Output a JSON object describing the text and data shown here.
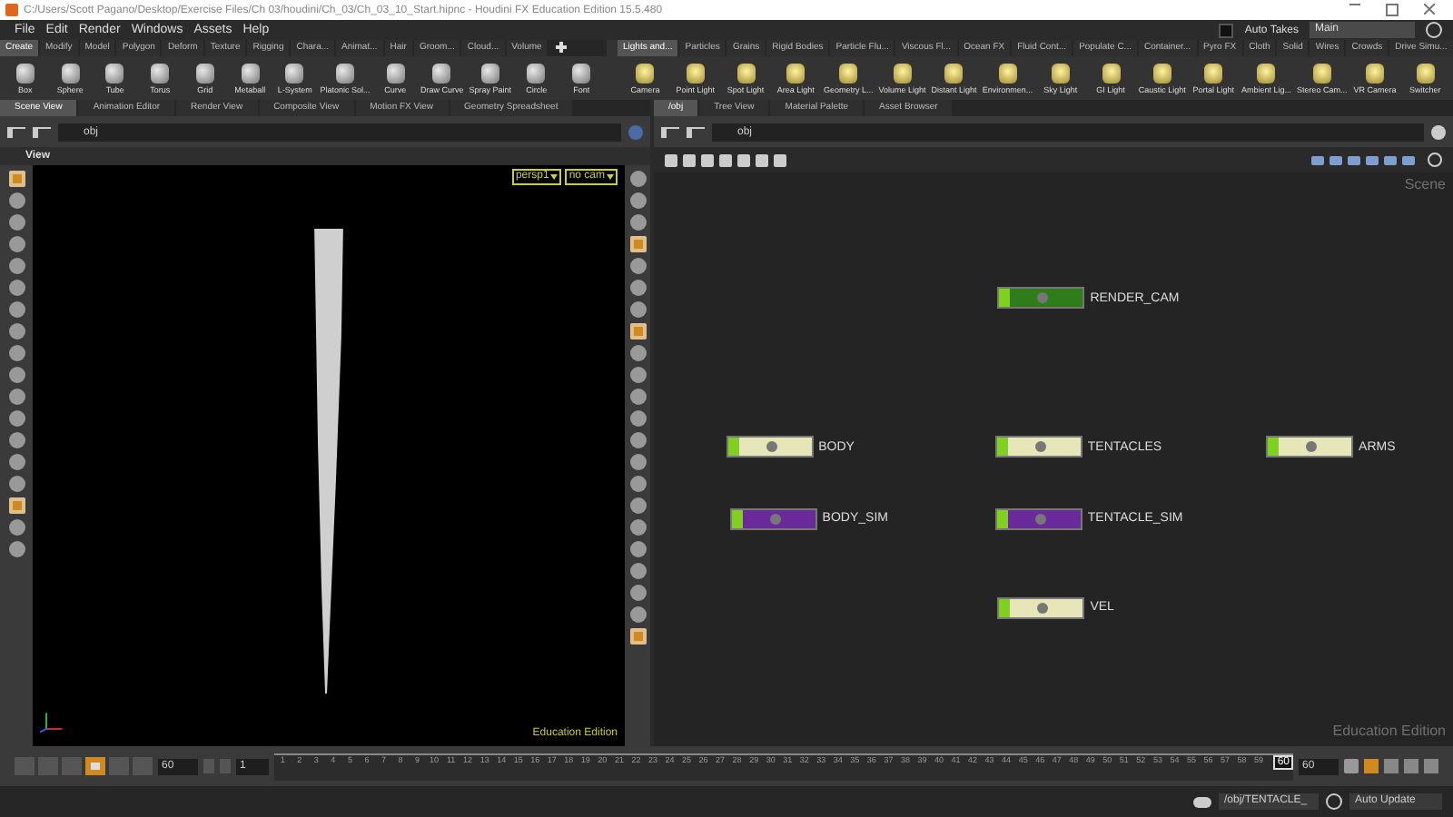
{
  "window": {
    "title": "C:/Users/Scott Pagano/Desktop/Exercise Files/Ch 03/houdini/Ch_03/Ch_03_10_Start.hipnc - Houdini FX Education Edition 15.5.480"
  },
  "menu": [
    "File",
    "Edit",
    "Render",
    "Windows",
    "Assets",
    "Help"
  ],
  "auto_takes": {
    "label": "Auto Takes",
    "checked": false
  },
  "take": "Main",
  "shelf_left": {
    "tabs": [
      {
        "label": "Create",
        "selected": true
      },
      {
        "label": "Modify",
        "selected": false
      },
      {
        "label": "Model",
        "selected": false
      },
      {
        "label": "Polygon",
        "selected": false
      },
      {
        "label": "Deform",
        "selected": false
      },
      {
        "label": "Texture",
        "selected": false
      },
      {
        "label": "Rigging",
        "selected": false
      },
      {
        "label": "Chara...",
        "selected": false
      },
      {
        "label": "Animat...",
        "selected": false
      },
      {
        "label": "Hair",
        "selected": false
      },
      {
        "label": "Groom...",
        "selected": false
      },
      {
        "label": "Cloud...",
        "selected": false
      },
      {
        "label": "Volume",
        "selected": false
      }
    ],
    "tools": [
      "Box",
      "Sphere",
      "Tube",
      "Torus",
      "Grid",
      "Metaball",
      "L-System",
      "Platonic Sol...",
      "Curve",
      "Draw Curve",
      "Spray Paint",
      "Circle",
      "Font"
    ]
  },
  "shelf_right": {
    "tabs": [
      {
        "label": "Lights and...",
        "selected": true
      },
      {
        "label": "Particles",
        "selected": false
      },
      {
        "label": "Grains",
        "selected": false
      },
      {
        "label": "Rigid Bodies",
        "selected": false
      },
      {
        "label": "Particle Flu...",
        "selected": false
      },
      {
        "label": "Viscous Fl...",
        "selected": false
      },
      {
        "label": "Ocean FX",
        "selected": false
      },
      {
        "label": "Fluid Cont...",
        "selected": false
      },
      {
        "label": "Populate C...",
        "selected": false
      },
      {
        "label": "Container...",
        "selected": false
      },
      {
        "label": "Pyro FX",
        "selected": false
      },
      {
        "label": "Cloth",
        "selected": false
      },
      {
        "label": "Solid",
        "selected": false
      },
      {
        "label": "Wires",
        "selected": false
      },
      {
        "label": "Crowds",
        "selected": false
      },
      {
        "label": "Drive Simu...",
        "selected": false
      }
    ],
    "tools": [
      "Camera",
      "Point Light",
      "Spot Light",
      "Area Light",
      "Geometry L...",
      "Volume Light",
      "Distant Light",
      "Environmen...",
      "Sky Light",
      "GI Light",
      "Caustic Light",
      "Portal Light",
      "Ambient Lig...",
      "Stereo Cam...",
      "VR Camera",
      "Switcher"
    ]
  },
  "left_pane": {
    "tabs": [
      {
        "label": "Scene View",
        "selected": true
      },
      {
        "label": "Animation Editor",
        "selected": false
      },
      {
        "label": "Render View",
        "selected": false
      },
      {
        "label": "Composite View",
        "selected": false
      },
      {
        "label": "Motion FX View",
        "selected": false
      },
      {
        "label": "Geometry Spreadsheet",
        "selected": false
      }
    ],
    "path": "obj",
    "viewport": {
      "title": "View",
      "camera": "persp1",
      "cam_menu": "no cam",
      "edition": "Education Edition",
      "left_tools": [
        {
          "selected": true
        },
        {
          "selected": false
        },
        {
          "selected": false
        },
        {
          "selected": false
        },
        {
          "selected": false
        },
        {
          "selected": false
        },
        {
          "selected": false
        },
        {
          "selected": false
        },
        {
          "selected": false
        },
        {
          "selected": false
        },
        {
          "selected": false
        },
        {
          "selected": false
        },
        {
          "selected": false
        },
        {
          "selected": false
        },
        {
          "selected": false
        },
        {
          "selected": true
        },
        {
          "selected": false
        },
        {
          "selected": false
        }
      ],
      "right_tools": [
        {
          "selected": false
        },
        {
          "selected": false
        },
        {
          "selected": false
        },
        {
          "selected": true
        },
        {
          "selected": false
        },
        {
          "selected": false
        },
        {
          "selected": false
        },
        {
          "selected": true
        },
        {
          "selected": false
        },
        {
          "selected": false
        },
        {
          "selected": false
        },
        {
          "selected": false
        },
        {
          "selected": false
        },
        {
          "selected": false
        },
        {
          "selected": false
        },
        {
          "selected": false
        },
        {
          "selected": false
        },
        {
          "selected": false
        },
        {
          "selected": false
        },
        {
          "selected": false
        },
        {
          "selected": false
        },
        {
          "selected": true
        }
      ]
    }
  },
  "right_pane": {
    "tabs": [
      {
        "label": "/obj",
        "selected": true
      },
      {
        "label": "Tree View",
        "selected": false
      },
      {
        "label": "Material Palette",
        "selected": false
      },
      {
        "label": "Asset Browser",
        "selected": false
      }
    ],
    "path": "obj",
    "network": {
      "context": "Scene",
      "edition": "Education Edition",
      "nodes": [
        {
          "name": "RENDER_CAM",
          "color": "#2e7d1a"
        },
        {
          "name": "BODY",
          "color": "#e6e6b8"
        },
        {
          "name": "TENTACLES",
          "color": "#e6e6b8"
        },
        {
          "name": "ARMS",
          "color": "#e6e6b8"
        },
        {
          "name": "BODY_SIM",
          "color": "#6a2a9a"
        },
        {
          "name": "TENTACLE_SIM",
          "color": "#6a2a9a"
        },
        {
          "name": "VEL",
          "color": "#e6e6b8"
        }
      ]
    }
  },
  "playback": [
    {
      "selected": false
    },
    {
      "selected": false
    },
    {
      "selected": false
    },
    {
      "selected": true
    },
    {
      "selected": false
    },
    {
      "selected": false
    }
  ],
  "timeline": {
    "end_frame": "60",
    "step": "1",
    "ticks": [
      "1",
      "2",
      "3",
      "4",
      "5",
      "6",
      "7",
      "8",
      "9",
      "10",
      "11",
      "12",
      "13",
      "14",
      "15",
      "16",
      "17",
      "18",
      "19",
      "20",
      "21",
      "22",
      "23",
      "24",
      "25",
      "26",
      "27",
      "28",
      "29",
      "30",
      "31",
      "32",
      "33",
      "34",
      "35",
      "36",
      "37",
      "38",
      "39",
      "40",
      "41",
      "42",
      "43",
      "44",
      "45",
      "46",
      "47",
      "48",
      "49",
      "50",
      "51",
      "52",
      "53",
      "54",
      "55",
      "56",
      "57",
      "58",
      "59"
    ],
    "current": "60",
    "current_field": "60"
  },
  "status": {
    "path": "/obj/TENTACLE_",
    "update": "Auto Update"
  }
}
